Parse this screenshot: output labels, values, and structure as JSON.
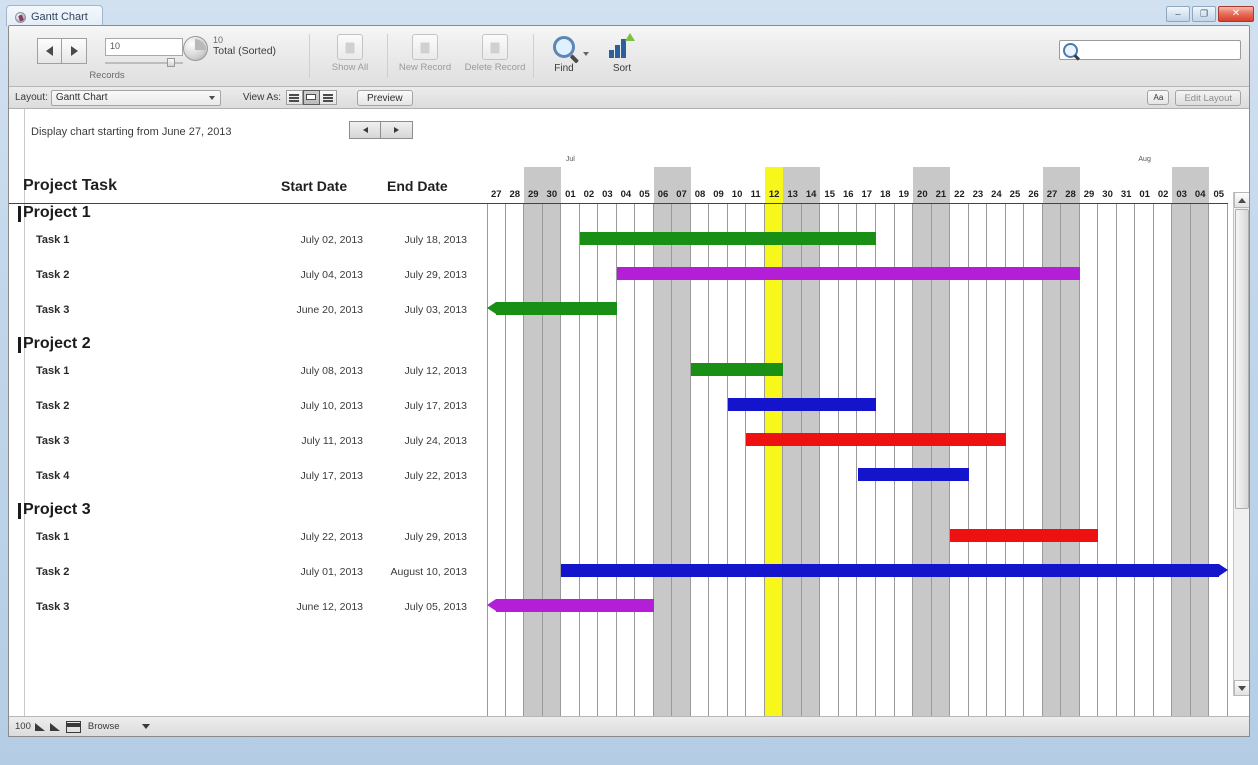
{
  "window": {
    "title": "Gantt Chart",
    "buttons": {
      "minimize": "–",
      "maximize": "❐",
      "close": "✕"
    }
  },
  "toolbar": {
    "prev_record_icon": "triangle-left-icon",
    "next_record_icon": "triangle-right-icon",
    "record_number": "10",
    "records_label": "Records",
    "total_count": "10",
    "total_label": "Total (Sorted)",
    "show_all_label": "Show All",
    "new_record_label": "New Record",
    "delete_record_label": "Delete Record",
    "find_label": "Find",
    "sort_label": "Sort",
    "search_placeholder": "",
    "search_value": ""
  },
  "layoutbar": {
    "layout_label": "Layout:",
    "layout_value": "Gantt Chart",
    "view_as_label": "View As:",
    "view_options": [
      "form-view",
      "list-view",
      "table-view"
    ],
    "view_active_index": 1,
    "preview_label": "Preview",
    "aa_label": "Aa",
    "edit_layout_label": "Edit Layout"
  },
  "chart_header": {
    "start_text": "Display chart starting from June 27, 2013",
    "prev_label": "◀",
    "next_label": "▶"
  },
  "columns": {
    "task": "Project Task",
    "start": "Start Date",
    "end": "End Date"
  },
  "statusbar": {
    "zoom_level": "100",
    "mode_label": "Browse"
  },
  "chart_data": {
    "type": "gantt",
    "title": "Gantt Chart",
    "timeline_start": "2013-06-27",
    "timeline_end": "2013-08-05",
    "today": "2013-07-12",
    "day_count": 40,
    "axis_days": [
      {
        "d": "27",
        "month": "",
        "weekend": false
      },
      {
        "d": "28",
        "month": "",
        "weekend": false
      },
      {
        "d": "29",
        "month": "",
        "weekend": true
      },
      {
        "d": "30",
        "month": "",
        "weekend": true
      },
      {
        "d": "01",
        "month": "Jul",
        "weekend": false
      },
      {
        "d": "02",
        "month": "",
        "weekend": false
      },
      {
        "d": "03",
        "month": "",
        "weekend": false
      },
      {
        "d": "04",
        "month": "",
        "weekend": false
      },
      {
        "d": "05",
        "month": "",
        "weekend": false
      },
      {
        "d": "06",
        "month": "",
        "weekend": true
      },
      {
        "d": "07",
        "month": "",
        "weekend": true
      },
      {
        "d": "08",
        "month": "",
        "weekend": false
      },
      {
        "d": "09",
        "month": "",
        "weekend": false
      },
      {
        "d": "10",
        "month": "",
        "weekend": false
      },
      {
        "d": "11",
        "month": "",
        "weekend": false
      },
      {
        "d": "12",
        "month": "",
        "weekend": false,
        "today": true
      },
      {
        "d": "13",
        "month": "",
        "weekend": true
      },
      {
        "d": "14",
        "month": "",
        "weekend": true
      },
      {
        "d": "15",
        "month": "",
        "weekend": false
      },
      {
        "d": "16",
        "month": "",
        "weekend": false
      },
      {
        "d": "17",
        "month": "",
        "weekend": false
      },
      {
        "d": "18",
        "month": "",
        "weekend": false
      },
      {
        "d": "19",
        "month": "",
        "weekend": false
      },
      {
        "d": "20",
        "month": "",
        "weekend": true
      },
      {
        "d": "21",
        "month": "",
        "weekend": true
      },
      {
        "d": "22",
        "month": "",
        "weekend": false
      },
      {
        "d": "23",
        "month": "",
        "weekend": false
      },
      {
        "d": "24",
        "month": "",
        "weekend": false
      },
      {
        "d": "25",
        "month": "",
        "weekend": false
      },
      {
        "d": "26",
        "month": "",
        "weekend": false
      },
      {
        "d": "27",
        "month": "",
        "weekend": true
      },
      {
        "d": "28",
        "month": "",
        "weekend": true
      },
      {
        "d": "29",
        "month": "",
        "weekend": false
      },
      {
        "d": "30",
        "month": "",
        "weekend": false
      },
      {
        "d": "31",
        "month": "",
        "weekend": false
      },
      {
        "d": "01",
        "month": "Aug",
        "weekend": false
      },
      {
        "d": "02",
        "month": "",
        "weekend": false
      },
      {
        "d": "03",
        "month": "",
        "weekend": true
      },
      {
        "d": "04",
        "month": "",
        "weekend": true
      },
      {
        "d": "05",
        "month": "",
        "weekend": false
      }
    ],
    "colors": {
      "green": "#1a8f16",
      "purple": "#b31fd6",
      "blue": "#1414cc",
      "red": "#ee1111",
      "weekend_band": "#c8c8c8",
      "today_band": "#f7f71c"
    },
    "groups": [
      {
        "name": "Project 1",
        "tasks": [
          {
            "name": "Task 1",
            "start": "July 02, 2013",
            "end": "July 18, 2013",
            "start_index": 5,
            "end_index": 21,
            "color": "green",
            "arrow_left": false,
            "arrow_right": false
          },
          {
            "name": "Task 2",
            "start": "July 04, 2013",
            "end": "July 29, 2013",
            "start_index": 7,
            "end_index": 32,
            "color": "purple",
            "arrow_left": false,
            "arrow_right": false
          },
          {
            "name": "Task 3",
            "start": "June 20, 2013",
            "end": "July 03, 2013",
            "start_index": 0,
            "end_index": 7,
            "color": "green",
            "arrow_left": true,
            "arrow_right": false
          }
        ]
      },
      {
        "name": "Project 2",
        "tasks": [
          {
            "name": "Task 1",
            "start": "July 08, 2013",
            "end": "July 12, 2013",
            "start_index": 11,
            "end_index": 16,
            "color": "green",
            "arrow_left": false,
            "arrow_right": false
          },
          {
            "name": "Task 2",
            "start": "July 10, 2013",
            "end": "July 17, 2013",
            "start_index": 13,
            "end_index": 21,
            "color": "blue",
            "arrow_left": false,
            "arrow_right": false
          },
          {
            "name": "Task 3",
            "start": "July 11, 2013",
            "end": "July 24, 2013",
            "start_index": 14,
            "end_index": 28,
            "color": "red",
            "arrow_left": false,
            "arrow_right": false
          },
          {
            "name": "Task 4",
            "start": "July 17, 2013",
            "end": "July 22, 2013",
            "start_index": 20,
            "end_index": 26,
            "color": "blue",
            "arrow_left": false,
            "arrow_right": false
          }
        ]
      },
      {
        "name": "Project 3",
        "tasks": [
          {
            "name": "Task 1",
            "start": "July 22, 2013",
            "end": "July 29, 2013",
            "start_index": 25,
            "end_index": 33,
            "color": "red",
            "arrow_left": false,
            "arrow_right": false
          },
          {
            "name": "Task 2",
            "start": "July 01, 2013",
            "end": "August 10, 2013",
            "start_index": 4,
            "end_index": 40,
            "color": "blue",
            "arrow_left": false,
            "arrow_right": true
          },
          {
            "name": "Task 3",
            "start": "June 12, 2013",
            "end": "July 05, 2013",
            "start_index": 0,
            "end_index": 9,
            "color": "purple",
            "arrow_left": true,
            "arrow_right": false
          }
        ]
      }
    ]
  }
}
